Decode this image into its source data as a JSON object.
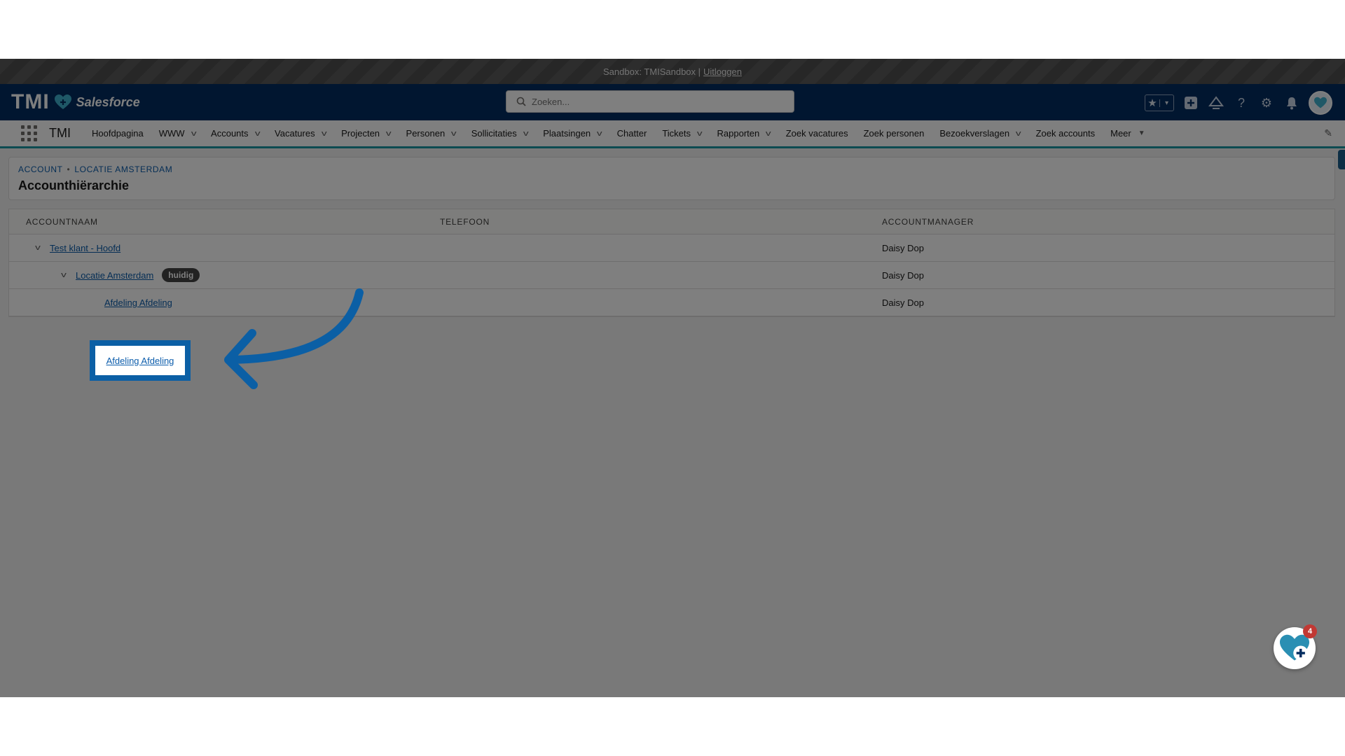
{
  "sandbox": {
    "text": "Sandbox: TMISandbox |",
    "logout": "Uitloggen"
  },
  "header": {
    "logo_text": "TMI",
    "logo_brand": "Salesforce",
    "search_placeholder": "Zoeken..."
  },
  "nav": {
    "app_name": "TMI",
    "items": [
      {
        "label": "Hoofdpagina",
        "dropdown": false
      },
      {
        "label": "WWW",
        "dropdown": true
      },
      {
        "label": "Accounts",
        "dropdown": true
      },
      {
        "label": "Vacatures",
        "dropdown": true
      },
      {
        "label": "Projecten",
        "dropdown": true
      },
      {
        "label": "Personen",
        "dropdown": true
      },
      {
        "label": "Sollicitaties",
        "dropdown": true
      },
      {
        "label": "Plaatsingen",
        "dropdown": true
      },
      {
        "label": "Chatter",
        "dropdown": false
      },
      {
        "label": "Tickets",
        "dropdown": true
      },
      {
        "label": "Rapporten",
        "dropdown": true
      },
      {
        "label": "Zoek vacatures",
        "dropdown": false
      },
      {
        "label": "Zoek personen",
        "dropdown": false
      },
      {
        "label": "Bezoekverslagen",
        "dropdown": true
      },
      {
        "label": "Zoek accounts",
        "dropdown": false
      },
      {
        "label": "Meer",
        "dropdown": true
      }
    ]
  },
  "page": {
    "breadcrumb": [
      "ACCOUNT",
      "LOCATIE AMSTERDAM"
    ],
    "title": "Accounthiërarchie"
  },
  "grid": {
    "columns": [
      "ACCOUNTNAAM",
      "TELEFOON",
      "ACCOUNTMANAGER"
    ],
    "rows": [
      {
        "name": "Test klant - Hoofd",
        "phone": "",
        "manager": "Daisy Dop",
        "level": 1,
        "expanded": true
      },
      {
        "name": "Locatie Amsterdam",
        "phone": "",
        "manager": "Daisy Dop",
        "level": 2,
        "expanded": true,
        "badge": "huidig"
      },
      {
        "name": "Afdeling Afdeling",
        "phone": "",
        "manager": "Daisy Dop",
        "level": 3
      }
    ]
  },
  "highlight": {
    "label": "Afdeling Afdeling"
  },
  "fab": {
    "badge_count": "4"
  },
  "colors": {
    "header": "#032d60",
    "link": "#0b5cab",
    "highlight": "#0b5fa5",
    "nav_accent": "#1b96a3"
  }
}
